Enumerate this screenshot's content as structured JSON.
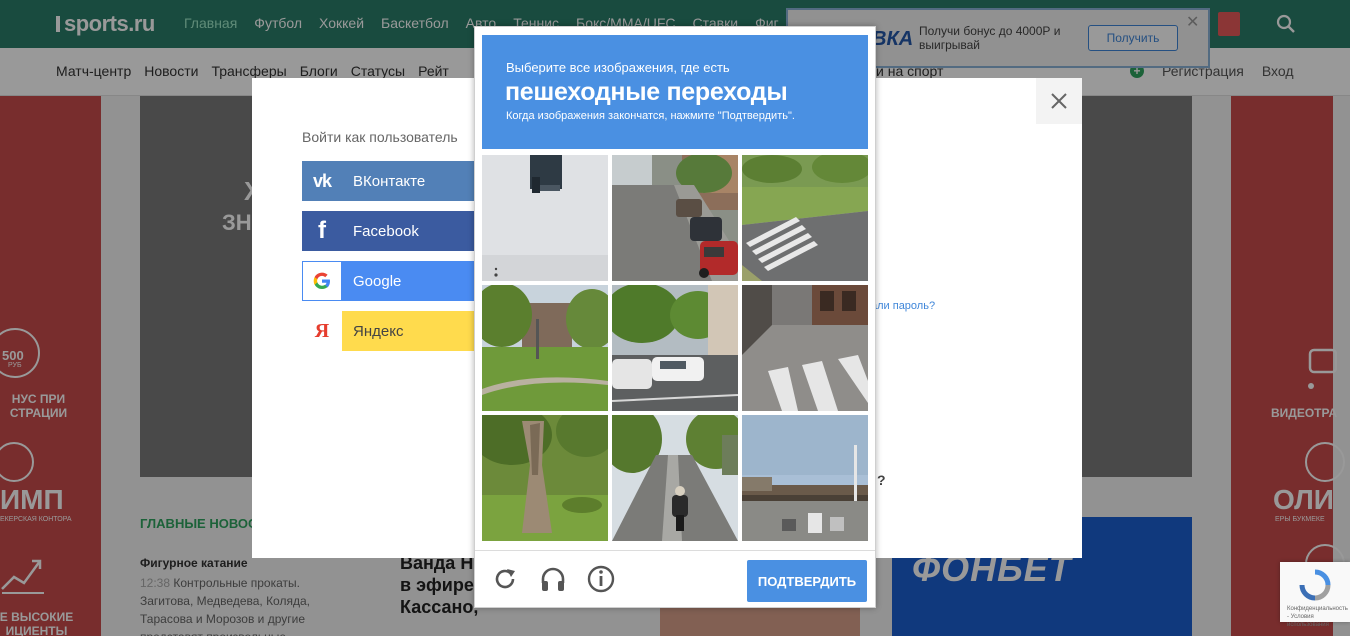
{
  "site": {
    "logo": "sports.ru",
    "main_nav": [
      "Главная",
      "Футбол",
      "Хоккей",
      "Баскетбол",
      "Авто",
      "Теннис",
      "Бокс/ММА/UFC",
      "Ставки",
      "Фиг"
    ],
    "sub_nav": [
      "Матч-центр",
      "Новости",
      "Трансферы",
      "Блоги",
      "Статусы",
      "Рейт"
    ],
    "sub_nav_extra": "и на спорт",
    "register": "Регистрация",
    "login": "Вход"
  },
  "bonus_banner": {
    "brand": "ВКА",
    "text": "Получи бонус до 4000Р и выигрывай",
    "button": "Получить"
  },
  "left_banner": {
    "chip": "500",
    "chip_sub": "РУБ",
    "text1": "НУС ПРИ",
    "text2": "СТРАЦИИ",
    "brand": "ИМП",
    "brand_sub": "ЕКЕРСКАЯ КОНТОРА",
    "text3": "Е ВЫСОКИЕ",
    "text4": "ИЦИЕНТЫ"
  },
  "right_banner": {
    "text1": "ВИДЕОТРА",
    "brand": "ОЛИ",
    "brand_sub": "ЕРЫ БУКМЕКЕ"
  },
  "hero": {
    "text1": "Х",
    "text2": "ЗН"
  },
  "news": {
    "heading": "ГЛАВНЫЕ НОВОС",
    "category": "Фигурное катание",
    "time": "12:38",
    "body": "Контрольные прокаты. Загитова, Медведева, Коляда, Тарасова и Морозов и другие представят произвольные"
  },
  "article": {
    "title": "Ванда Н футбол Плакала в эфире, ругалась с Кассано,"
  },
  "fonbet": {
    "text": "ФОНБЕТ"
  },
  "login_modal": {
    "title": "Войти как пользователь",
    "vk": "ВКонтакте",
    "facebook": "Facebook",
    "google": "Google",
    "yandex": "Яндекс",
    "forgot": "али пароль?",
    "qmark": "?"
  },
  "captcha": {
    "line1": "Выберите все изображения, где есть",
    "line2": "пешеходные переходы",
    "line3": "Когда изображения закончатся, нажмите \"Подтвердить\".",
    "verify": "ПОДТВЕРДИТЬ",
    "tiles": [
      "traffic-light-closeup",
      "parked-cars-street",
      "crosswalk-park",
      "trees-lawn",
      "cars-trees-street",
      "crosswalk-corner",
      "tree-trunk-park",
      "cyclist-bike-lane",
      "overpass-highway"
    ]
  },
  "recaptcha_badge": {
    "text": "Конфиденциальность - Условия использования"
  },
  "colors": {
    "captcha_blue": "#4a90e2",
    "vk": "#5280b7",
    "facebook": "#3b5ba0",
    "google": "#4a8bf2",
    "yandex": "#ffdb4d",
    "site_green": "#2a7d6a"
  }
}
